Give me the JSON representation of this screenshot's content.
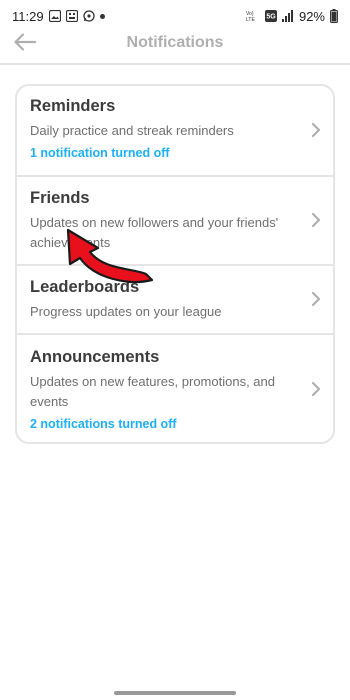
{
  "status_bar": {
    "time": "11:29",
    "battery": "92%",
    "network_label": "5G",
    "icons": [
      "image-icon",
      "sim-card-icon",
      "whatsapp-icon",
      "notification-dot",
      "volte-icon",
      "5g-icon",
      "signal-icon",
      "battery-icon"
    ]
  },
  "header": {
    "title": "Notifications",
    "back_icon": "arrow-left-icon"
  },
  "items": [
    {
      "title": "Reminders",
      "description": "Daily practice and streak reminders",
      "status": "1 notification turned off"
    },
    {
      "title": "Friends",
      "description": "Updates on new followers and your friends' achievements",
      "status": ""
    },
    {
      "title": "Leaderboards",
      "description": "Progress updates on your league",
      "status": ""
    },
    {
      "title": "Announcements",
      "description": "Updates on new features, promotions, and events",
      "status": "2 notifications turned off"
    }
  ],
  "colors": {
    "accent": "#1cb0f6",
    "title_text": "#3c3c3c",
    "muted_text": "#afafaf",
    "border": "#e5e5e5",
    "annotation_arrow": "#e8101c"
  }
}
